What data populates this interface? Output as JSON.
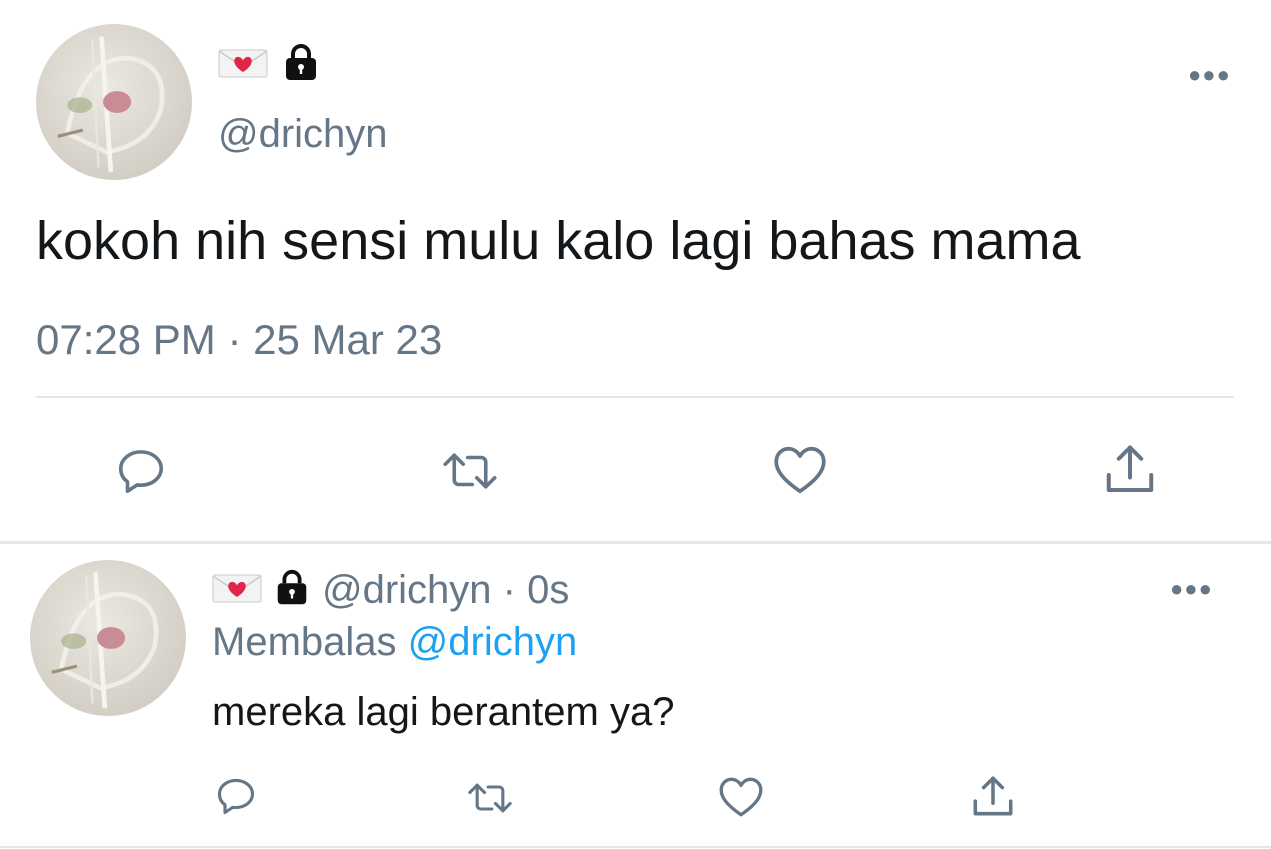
{
  "main_tweet": {
    "display_name_icons": [
      "love-letter-icon",
      "lock-icon"
    ],
    "handle": "@drichyn",
    "text": "kokoh nih sensi mulu kalo lagi bahas mama",
    "timestamp": "07:28 PM · 25 Mar 23",
    "actions": [
      "reply-icon",
      "retweet-icon",
      "like-icon",
      "share-icon"
    ]
  },
  "reply_tweet": {
    "display_name_icons": [
      "love-letter-icon",
      "lock-icon"
    ],
    "handle_time": "@drichyn · 0s",
    "replying_prefix": "Membalas",
    "replying_to": "@drichyn",
    "text": "mereka lagi berantem ya?",
    "actions": [
      "reply-icon",
      "retweet-icon",
      "like-icon",
      "share-icon"
    ]
  },
  "colors": {
    "text": "#14171a",
    "muted": "#657786",
    "link": "#1da1f2",
    "divider": "#e1e8ed"
  }
}
